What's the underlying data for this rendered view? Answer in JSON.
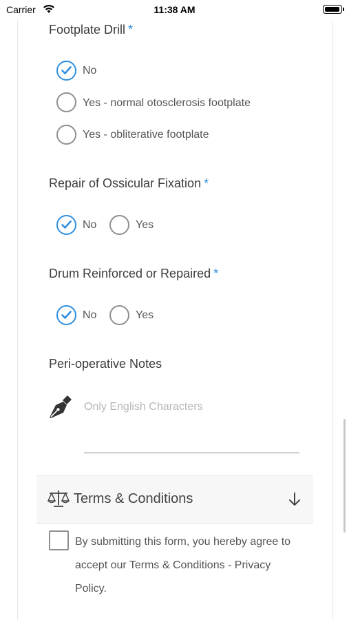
{
  "status": {
    "carrier": "Carrier",
    "time": "11:38 AM"
  },
  "questions": [
    {
      "label": "Footplate Drill",
      "required": "*",
      "options": [
        "No",
        "Yes - normal otosclerosis footplate",
        "Yes - obliterative footplate"
      ],
      "selected": "No"
    },
    {
      "label": "Repair of Ossicular Fixation",
      "required": "*",
      "options": [
        "No",
        "Yes"
      ],
      "selected": "No"
    },
    {
      "label": "Drum Reinforced or Repaired",
      "required": "*",
      "options": [
        "No",
        "Yes"
      ],
      "selected": "No"
    }
  ],
  "notes": {
    "label": "Peri-operative Notes",
    "placeholder": "Only English Characters",
    "icon": "pen-nib-icon"
  },
  "terms": {
    "title": "Terms & Conditions",
    "agree_text": "By submitting this form, you hereby agree to accept our Terms & Conditions - Privacy Policy.",
    "checked": false
  },
  "colors": {
    "accent": "#2f8fe0",
    "radio_border": "#8f8f8f"
  }
}
